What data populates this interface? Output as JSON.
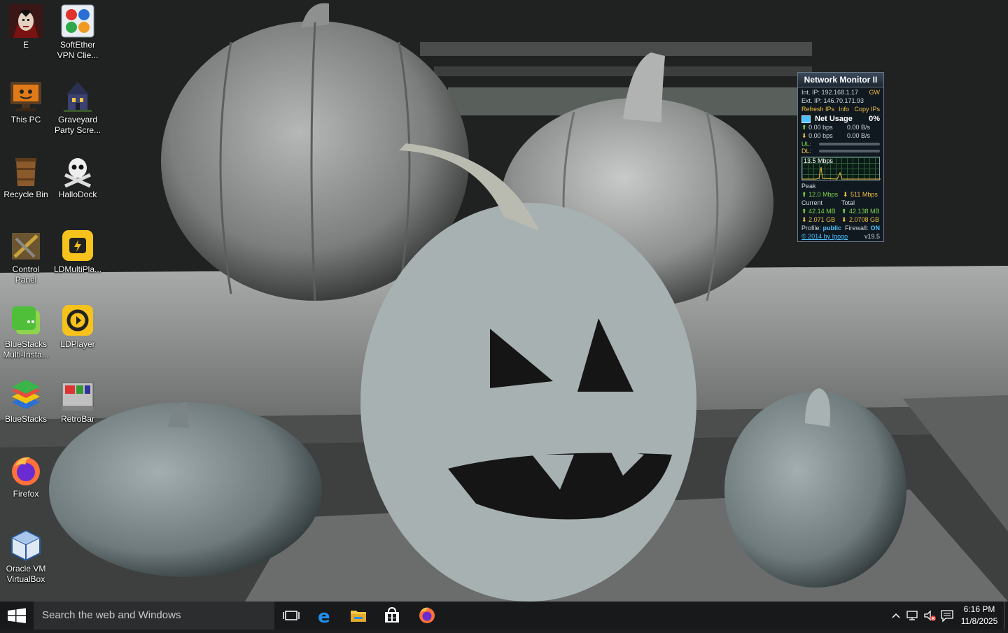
{
  "desktop": {
    "icons": [
      {
        "label": "E"
      },
      {
        "label": "SoftEther VPN Clie..."
      },
      {
        "label": "This PC"
      },
      {
        "label": "Graveyard Party Scre..."
      },
      {
        "label": "Recycle Bin"
      },
      {
        "label": "HalloDock"
      },
      {
        "label": "Control Panel"
      },
      {
        "label": "LDMultiPla..."
      },
      {
        "label": "BlueStacks Multi-Insta..."
      },
      {
        "label": "LDPlayer"
      },
      {
        "label": "BlueStacks"
      },
      {
        "label": "RetroBar"
      },
      {
        "label": "Firefox"
      },
      {
        "label": "Oracle VM VirtualBox"
      }
    ]
  },
  "network_monitor": {
    "title": "Network Monitor II",
    "int_ip": "Int. IP: 192.168.1.17",
    "gw": "GW",
    "ext_ip": "Ext. IP: 146.70.171.93",
    "refresh_ips": "Refresh IPs",
    "info": "Info",
    "copy_ips": "Copy IPs",
    "net_usage_label": "Net Usage",
    "net_usage_value": "0%",
    "up_bps": "0.00 bps",
    "up_bs": "0.00 B/s",
    "down_bps": "0.00 bps",
    "down_bs": "0.00 B/s",
    "ul_label": "UL:",
    "dl_label": "DL:",
    "graph_label": "13.5 Mbps",
    "peak_label": "Peak",
    "peak_up": "12.0 Mbps",
    "peak_down": "511 Mbps",
    "current_label": "Current",
    "total_label": "Total",
    "current_up": "42.14 MB",
    "total_up": "42.138 MB",
    "current_down": "2.071 GB",
    "total_down": "2.0708 GB",
    "profile_label": "Profile:",
    "profile_value": "public",
    "firewall_label": "Firewall:",
    "firewall_value": "ON",
    "credit": "© 2014 by Igogo",
    "version": "v19.5"
  },
  "taskbar": {
    "search_placeholder": "Search the web and Windows",
    "pinned": [
      "task-view",
      "edge",
      "file-explorer",
      "store",
      "firefox"
    ],
    "tray": [
      "chevron-up-icon",
      "network-icon",
      "volume-muted-icon",
      "notifications-icon"
    ],
    "clock_time": "6:16 PM",
    "clock_date": "11/8/2025"
  },
  "colors": {
    "taskbar_bg": "#17191b",
    "search_bg": "#2b2d2f",
    "gadget_bg": "#101820",
    "accent_yellow": "#f0c040",
    "accent_green": "#7fd64a",
    "link_blue": "#4cc3ff"
  }
}
